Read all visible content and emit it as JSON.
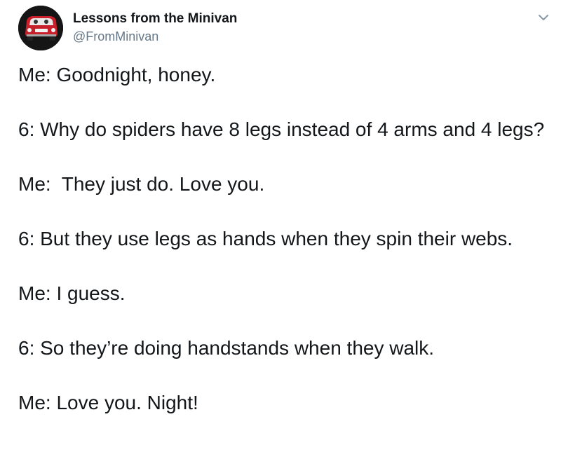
{
  "tweet": {
    "author": {
      "display_name": "Lessons from the Minivan",
      "handle": "@FromMinivan",
      "avatar_icon": "minivan-avatar-icon"
    },
    "menu_icon": "chevron-down-icon",
    "lines": [
      "Me: Goodnight, honey.",
      "6: Why do spiders have 8 legs instead of 4 arms and 4 legs?",
      "Me:  They just do. Love you.",
      "6: But they use legs as hands when they spin their webs.",
      "Me: I guess.",
      "6: So they’re doing handstands when they walk.",
      "Me: Love you. Night!"
    ]
  },
  "colors": {
    "text": "#14171a",
    "secondary_text": "#657786",
    "avatar_bg": "#151515",
    "avatar_car": "#c8202a"
  }
}
